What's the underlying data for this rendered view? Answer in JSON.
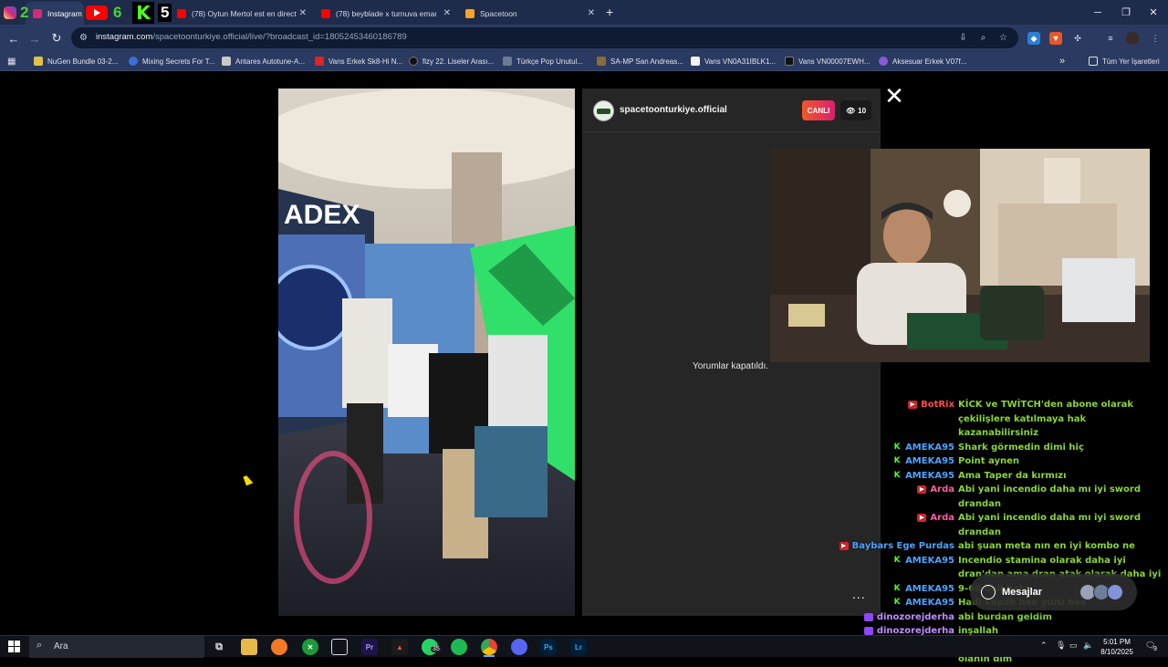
{
  "browser": {
    "tabs": [
      {
        "label": "Instagram",
        "icon": "instagram-icon",
        "color": "#d62976"
      },
      {
        "label": "(78) Oytun Mertol est en direct",
        "icon": "youtube-icon",
        "color": "#ff0000"
      },
      {
        "label": "(78) beyblade x turnuva emar",
        "icon": "youtube-icon",
        "color": "#ff0000"
      },
      {
        "label": "Spacetoon",
        "icon": "spacetoon-icon",
        "color": "#f5a623"
      }
    ],
    "new_tab_label": "+",
    "address": {
      "host": "instagram.com",
      "path": "/spacetoonturkiye.official/live/?broadcast_id=18052453460186789"
    },
    "bookmarks": [
      "NuGen Bundle 03-2...",
      "Mixing Secrets For T...",
      "Antares Autotune-A...",
      "Vans Erkek Sk8-Hi N...",
      "fizy 22. Liseler Arası...",
      "Türkçe Pop Unutul...",
      "SA-MP San Andreas...",
      "Vans VN0A31IBLK1...",
      "Vans VN00007EWH...",
      "Aksesuar Erkek V07f..."
    ],
    "bookmarks_more": "»",
    "all_bookmarks": "Tüm Yer İşaretleri"
  },
  "overlay_counters": {
    "instagram": "2",
    "youtube": "6",
    "kick": "5"
  },
  "live": {
    "username": "spacetoonturkiye.official",
    "live_badge": "CANLI",
    "viewer_count": "10",
    "comments_closed": "Yorumlar kapatıldı.",
    "more": "..."
  },
  "chat": [
    {
      "platform": "yt",
      "user": "BotRix",
      "user_color": "#ff4a4a",
      "text": "KİCK ve TWİTCH'den abone olarak çekilişlere katılmaya hak kazanabilirsiniz"
    },
    {
      "platform": "kick",
      "user": "AMEKA95",
      "user_color": "#4aa3ff",
      "text": "Shark görmedin dimi hiç"
    },
    {
      "platform": "kick",
      "user": "AMEKA95",
      "user_color": "#4aa3ff",
      "text": "Point aynen"
    },
    {
      "platform": "kick",
      "user": "AMEKA95",
      "user_color": "#4aa3ff",
      "text": "Ama Taper da kırmızı"
    },
    {
      "platform": "yt",
      "user": "Arda",
      "user_color": "#ff5aa8",
      "text": "Abi yani incendio daha mı iyi sword drandan"
    },
    {
      "platform": "yt",
      "user": "Arda",
      "user_color": "#ff5aa8",
      "text": "Abi yani incendio daha mı iyi sword drandan"
    },
    {
      "platform": "yt",
      "user": "Baybars Ege Purdas",
      "user_color": "#4aa3ff",
      "text": "abi şuan meta nın en iyi kombo ne"
    },
    {
      "platform": "kick",
      "user": "AMEKA95",
      "user_color": "#4aa3ff",
      "text": "Incendio stamina olarak daha iyi dran'dan ama dran atak olarak daha iyi"
    },
    {
      "platform": "kick",
      "user": "AMEKA95",
      "user_color": "#4aa3ff",
      "text": "9-60 ball baba"
    },
    {
      "platform": "kick",
      "user": "AMEKA95",
      "user_color": "#4aa3ff",
      "text": "Hadi kapak bee yürü bee"
    },
    {
      "platform": "tw",
      "user": "dinozorejderha",
      "user_color": "#c08cff",
      "text": "abi burdan geldim"
    },
    {
      "platform": "tw",
      "user": "dinozorejderha",
      "user_color": "#c08cff",
      "text": "inşallah"
    },
    {
      "platform": "kick",
      "user": "AMEKA95",
      "user_color": "#4aa3ff",
      "text": "Ha bu az öncekinin tanıdığı ash şapkalı olanın dim"
    }
  ],
  "messages_label": "Mesajlar",
  "taskbar": {
    "search_placeholder": "Ara",
    "whatsapp_badge": "35",
    "time": "5:01 PM",
    "date": "8/10/2025",
    "notifications": "9"
  }
}
